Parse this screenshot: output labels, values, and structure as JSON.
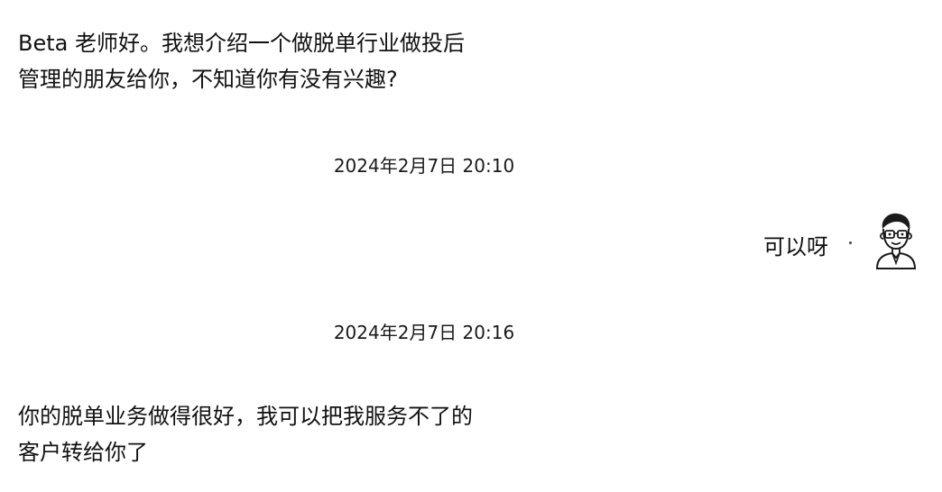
{
  "messages": {
    "incoming_1": {
      "lines": [
        "Beta 老师好。我想介绍一个做脱单行业做投后",
        "管理的朋友给你，不知道你有没有兴趣?"
      ]
    },
    "timestamp_1": "2024年2月7日 20:10",
    "outgoing_1": "可以呀",
    "timestamp_2": "2024年2月7日 20:16",
    "incoming_2": {
      "lines": [
        "你的脱单业务做得很好，我可以把我服务不了的",
        "客户转给你了"
      ]
    }
  },
  "avatar": {
    "icon": "cartoon-person-with-glasses-icon"
  }
}
